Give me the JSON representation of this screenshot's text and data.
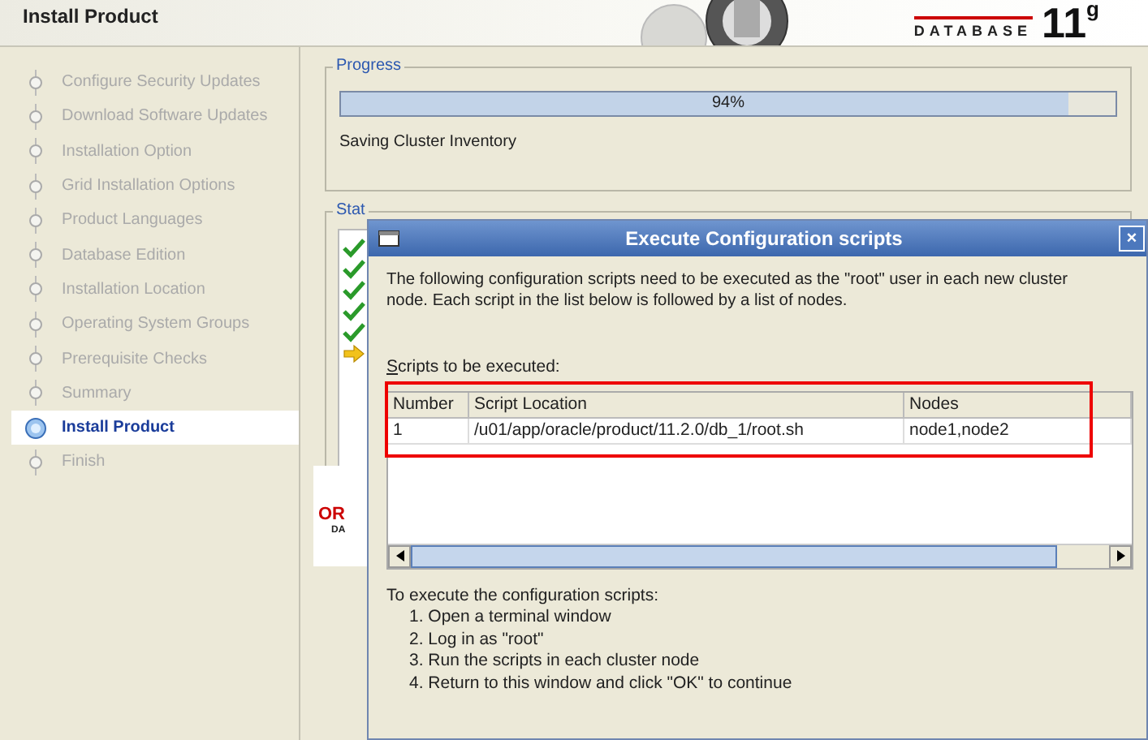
{
  "window": {
    "title": "Install Product"
  },
  "logo": {
    "product": "DATABASE",
    "version": "11$^{g}$"
  },
  "sidebar": {
    "items": [
      {
        "label": "Configure Security Updates",
        "selected": false
      },
      {
        "label": "Download Software Updates",
        "selected": false
      },
      {
        "label": "Installation Option",
        "selected": false
      },
      {
        "label": "Grid Installation Options",
        "selected": false
      },
      {
        "label": "Product Languages",
        "selected": false
      },
      {
        "label": "Database Edition",
        "selected": false
      },
      {
        "label": "Installation Location",
        "selected": false
      },
      {
        "label": "Operating System Groups",
        "selected": false
      },
      {
        "label": "Prerequisite Checks",
        "selected": false
      },
      {
        "label": "Summary",
        "selected": false
      },
      {
        "label": "Install Product",
        "selected": true
      },
      {
        "label": "Finish",
        "selected": false
      }
    ]
  },
  "progress": {
    "legend": "Progress",
    "level": 0.94,
    "reading": "94%",
    "message": "Saving Cluster Inventory"
  },
  "status": {
    "legend": "Stat",
    "items": [
      {
        "kind": "done"
      },
      {
        "kind": "done"
      },
      {
        "kind": "done"
      },
      {
        "kind": "done"
      },
      {
        "kind": "done"
      },
      {
        "kind": "current"
      }
    ]
  },
  "footer_logo": {
    "line_1": "OR",
    "line_2": "DA"
  },
  "dialog": {
    "title": "Execute Configuration scripts",
    "close": "×",
    "intro": "The following configuration scripts need to be executed as the \"root\" user in each new cluster node. Each script in the list below is followed by a list of nodes.",
    "list_label": "Scripts to be executed:",
    "table": {
      "columns": [
        "Number",
        "Script Location",
        "Nodes"
      ],
      "rows": [
        [
          "1",
          "/u01/app/oracle/product/11.2.0/db_1/root.sh",
          "node1,node2"
        ]
      ]
    },
    "instructions_title": "To execute the configuration scripts:",
    "steps": [
      "1. Open a terminal window",
      "2. Log in as \"root\"",
      "3. Run the scripts in each cluster node",
      "4. Return to this window and click \"OK\" to continue"
    ]
  }
}
